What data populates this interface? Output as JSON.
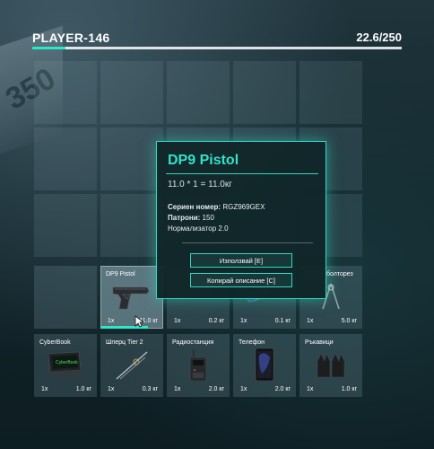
{
  "header": {
    "player_name": "PLAYER-146",
    "weight": "22.6/250",
    "weight_fraction": 0.09
  },
  "tooltip": {
    "title": "DP9 Pistol",
    "formula": "11.0 * 1 = 11.0кг",
    "serial_label": "Сериен номер:",
    "serial_value": "RGZ969GEX",
    "ammo_label": "Патрони:",
    "ammo_value": "150",
    "normalizer_label": "Нормализатор",
    "normalizer_value": "2.0",
    "use_button": "Използвай [E]",
    "copy_button": "Копирай описание [C]"
  },
  "inventory": {
    "row4": [
      {
        "name": "",
        "qty": "",
        "weight": ""
      },
      {
        "name": "DP9 Pistol",
        "qty": "1x",
        "weight": "11.0 кг",
        "durability": 0.75,
        "icon": "pistol-icon"
      },
      {
        "name": "",
        "qty": "1x",
        "weight": "0.2 кг",
        "icon": "item-icon"
      },
      {
        "name": "",
        "qty": "1x",
        "weight": "0.1 кг",
        "icon": "item-icon"
      },
      {
        "name": "болторез",
        "qty": "1x",
        "weight": "5.0 кг",
        "icon": "boltcutter-icon"
      }
    ],
    "row5": [
      {
        "name": "CyberBook",
        "qty": "1x",
        "weight": "1.0 кг",
        "icon": "laptop-icon"
      },
      {
        "name": "Шперц Tier 2",
        "qty": "1x",
        "weight": "0.3 кг",
        "icon": "lockpick-icon"
      },
      {
        "name": "Радиостанция",
        "qty": "1x",
        "weight": "2.0 кг",
        "icon": "radio-icon"
      },
      {
        "name": "Телефон",
        "qty": "1x",
        "weight": "2.0 кг",
        "icon": "phone-icon"
      },
      {
        "name": "Ръкавици",
        "qty": "1x",
        "weight": "1.0 кг",
        "icon": "gloves-icon"
      }
    ]
  },
  "colors": {
    "accent": "#2ee6c8"
  }
}
